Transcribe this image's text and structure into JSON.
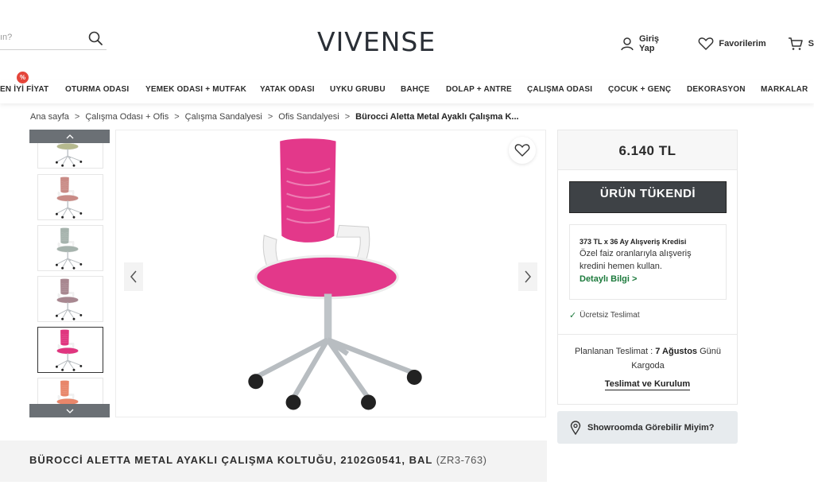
{
  "header": {
    "search_placeholder": "ın?",
    "logo": "VIVENSE",
    "login_label": "Giriş Yap",
    "favorites_label": "Favorilerim",
    "cart_label": "S"
  },
  "nav": {
    "badge": "%",
    "items": [
      "EN İYİ FİYAT",
      "OTURMA ODASI",
      "YEMEK ODASI + MUTFAK",
      "YATAK ODASI",
      "UYKU GRUBU",
      "BAHÇE",
      "DOLAP + ANTRE",
      "ÇALIŞMA ODASI",
      "ÇOCUK + GENÇ",
      "DEKORASYON",
      "MARKALAR"
    ]
  },
  "breadcrumb": {
    "items": [
      "Ana sayfa",
      "Çalışma Odası + Ofis",
      "Çalışma Sandalyesi",
      "Ofis Sandalyesi"
    ],
    "current": "Bürocci Aletta Metal Ayaklı Çalışma K...",
    "separator": ">"
  },
  "gallery": {
    "thumb_colors": [
      "#b5b98e",
      "#c98b86",
      "#a6b3ad",
      "#a88790",
      "#e0357f",
      "#e8866a"
    ],
    "active_index": 4,
    "main_color": "#e3388a"
  },
  "panel": {
    "price": "6.140 TL",
    "soldout_label": "ÜRÜN TÜKENDİ",
    "credit_title": "373 TL x 36 Ay Alışveriş Kredisi",
    "credit_text": "Özel faiz oranlarıyla alışveriş kredini hemen kullan.",
    "credit_link": "Detaylı Bilgi >",
    "free_shipping": "Ücretsiz Teslimat",
    "delivery_prefix": "Planlanan Teslimat : ",
    "delivery_date": "7 Ağustos",
    "delivery_suffix": " Günü Kargoda",
    "delivery_link": "Teslimat ve Kurulum",
    "showroom_label": "Showroomda Görebilir Miyim?"
  },
  "product": {
    "title": "BÜROCCİ ALETTA METAL AYAKLI ÇALIŞMA KOLTUĞU, 2102G0541, BAL",
    "sku": "(ZR3-763)"
  }
}
